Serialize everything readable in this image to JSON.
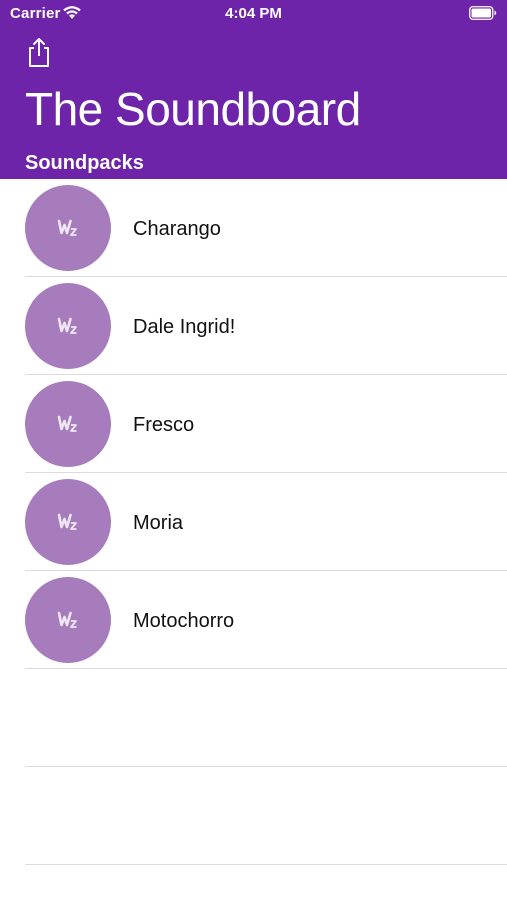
{
  "status_bar": {
    "carrier": "Carrier",
    "time": "4:04 PM"
  },
  "header": {
    "title": "The Soundboard",
    "section_title": "Soundpacks",
    "background_color": "#6e24a9"
  },
  "soundpacks": [
    {
      "name": "Charango",
      "icon": "wz-logo-icon"
    },
    {
      "name": "Dale Ingrid!",
      "icon": "wz-logo-icon"
    },
    {
      "name": "Fresco",
      "icon": "wz-logo-icon"
    },
    {
      "name": "Moria",
      "icon": "wz-logo-icon"
    },
    {
      "name": "Motochorro",
      "icon": "wz-logo-icon"
    }
  ],
  "colors": {
    "accent": "#6e24a9",
    "avatar": "#a67cbd"
  }
}
